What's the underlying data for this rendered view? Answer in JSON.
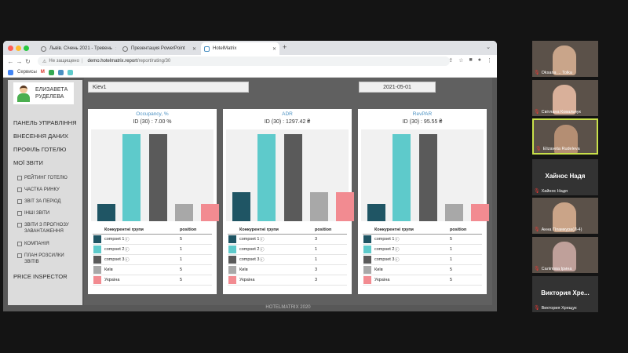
{
  "browser": {
    "tabs": [
      {
        "title": "Львів. Січень 2021 - Тревень",
        "active": false
      },
      {
        "title": "Презентация PowerPoint",
        "active": false
      },
      {
        "title": "HotelMatrix",
        "active": true
      }
    ],
    "security_label": "Не защищено",
    "url_host": "demo.hotelmatrix.report",
    "url_path": "/report/rating/30",
    "bookmarks": [
      "Сервисы"
    ]
  },
  "sidebar": {
    "user_first": "ЕЛИЗАВЕТА",
    "user_last": "РУДЕЛЕВА",
    "menu": {
      "panel": "ПАНЕЛЬ УПРАВЛІННЯ",
      "data_entry": "ВНЕСЕННЯ ДАНИХ",
      "hotel_profile": "ПРОФІЛЬ ГОТЕЛЮ",
      "my_reports": "МОЇ ЗВІТИ",
      "price_inspector": "PRICE INSPECTOR"
    },
    "submenu": [
      {
        "label": "РЕЙТИНГ ГОТЕЛЮ"
      },
      {
        "label": "ЧАСТКА РИНКУ"
      },
      {
        "label": "ЗВІТ ЗА ПЕРІОД"
      },
      {
        "label": "ІНШІ ЗВІТИ"
      },
      {
        "label": "ЗВІТИ З ПРОГНОЗУ ЗАВАНТАЖЕННЯ"
      },
      {
        "label": "КОМПАНІЯ"
      },
      {
        "label": "ПЛАН РОЗСИЛКИ ЗВІТІВ"
      }
    ]
  },
  "filters": {
    "city": "Kiev1",
    "date": "2021-05-01"
  },
  "table_headers": {
    "group": "Конкурентні групи",
    "position": "position"
  },
  "colors": {
    "compset1": "#1f5564",
    "compset2": "#5ecacb",
    "compset3": "#5a5a5a",
    "kyiv": "#a8a8a8",
    "ukraine": "#f28b91"
  },
  "chart_data": [
    {
      "type": "bar",
      "title": "Occupancy, %",
      "subtitle": "ID (30) : 7.00 %",
      "categories": [
        "compset 1",
        "compset 2",
        "compset 3",
        "Київ",
        "Україна"
      ],
      "values": [
        20,
        100,
        100,
        20,
        20
      ],
      "ylim": [
        0,
        105
      ]
    },
    {
      "type": "bar",
      "title": "ADR",
      "subtitle": "ID (30) : 1297.42 ₴",
      "categories": [
        "compset 1",
        "compset 2",
        "compset 3",
        "Київ",
        "Україна"
      ],
      "values": [
        33,
        100,
        100,
        33,
        33
      ],
      "ylim": [
        0,
        105
      ]
    },
    {
      "type": "bar",
      "title": "RevPAR",
      "subtitle": "ID (30) : 95.55 ₴",
      "categories": [
        "compset 1",
        "compset 2",
        "compset 3",
        "Київ",
        "Україна"
      ],
      "values": [
        20,
        100,
        100,
        20,
        20
      ],
      "ylim": [
        0,
        105
      ]
    }
  ],
  "rankings": [
    {
      "rows": [
        {
          "name": "compset 1",
          "pos": "5"
        },
        {
          "name": "compset 2",
          "pos": "1"
        },
        {
          "name": "compset 3",
          "pos": "1"
        },
        {
          "name": "Київ",
          "pos": "5"
        },
        {
          "name": "Україна",
          "pos": "5"
        }
      ]
    },
    {
      "rows": [
        {
          "name": "compset 1",
          "pos": "3"
        },
        {
          "name": "compset 2",
          "pos": "1"
        },
        {
          "name": "compset 3",
          "pos": "1"
        },
        {
          "name": "Київ",
          "pos": "3"
        },
        {
          "name": "Україна",
          "pos": "3"
        }
      ]
    },
    {
      "rows": [
        {
          "name": "compset 1",
          "pos": "5"
        },
        {
          "name": "compset 2",
          "pos": "1"
        },
        {
          "name": "compset 3",
          "pos": "1"
        },
        {
          "name": "Київ",
          "pos": "5"
        },
        {
          "name": "Україна",
          "pos": "5"
        }
      ]
    }
  ],
  "footer": "HOTELMATRIX 2020",
  "participants": [
    {
      "name": "Оksana ... Tolka",
      "big": "",
      "face": "#c9a58a",
      "active": false
    },
    {
      "name": "Світлана Ковальчук",
      "big": "",
      "face": "#d9b09a",
      "active": false
    },
    {
      "name": "Elizaveta Rudeleva",
      "big": "",
      "face": "#b48e73",
      "active": true
    },
    {
      "name": "Хайнос Надя",
      "big": "Хайнос Надя",
      "face": "",
      "active": false
    },
    {
      "name": "Анна Пламкура(Л-4)",
      "big": "",
      "face": "#caa488",
      "active": false
    },
    {
      "name": "Саліпова Ірина",
      "big": "",
      "face": "#bfa09a",
      "active": false
    },
    {
      "name": "Виктория Хрещук",
      "big": "Виктория Хре...",
      "face": "",
      "active": false
    }
  ]
}
